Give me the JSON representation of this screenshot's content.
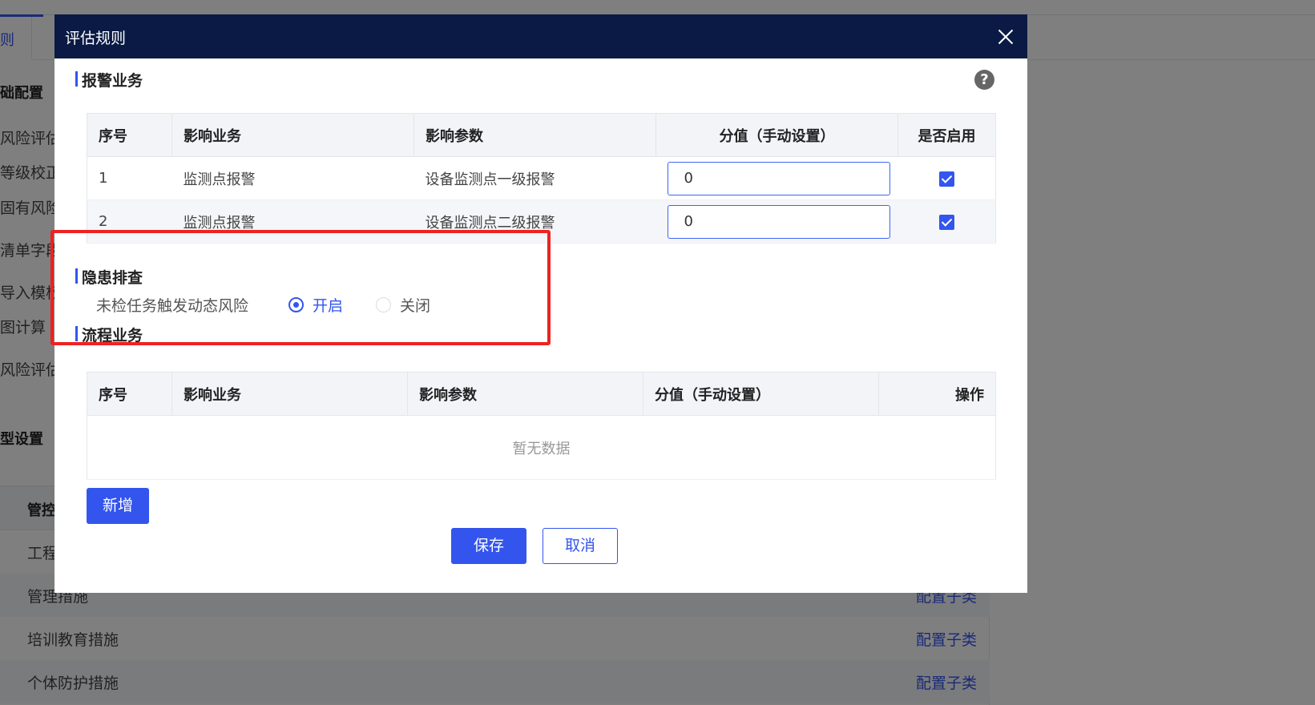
{
  "background": {
    "tab_label": "则",
    "headings": [
      "础配置",
      "型设置"
    ],
    "menu_items": [
      "风险评估",
      "等级校正",
      "固有风险",
      "清单字段",
      "导入模板",
      "图计算",
      "风险评估"
    ],
    "table_header": "管控",
    "rows": [
      {
        "label": "工程",
        "link": ""
      },
      {
        "label": "管理措施",
        "link": "配置子类"
      },
      {
        "label": "培训教育措施",
        "link": "配置子类"
      },
      {
        "label": "个体防护措施",
        "link": "配置子类"
      }
    ]
  },
  "modal": {
    "title": "评估规则",
    "alert_section": {
      "title": "报警业务",
      "columns": [
        "序号",
        "影响业务",
        "影响参数",
        "分值（手动设置）",
        "是否启用"
      ],
      "rows": [
        {
          "index": "1",
          "business": "监测点报警",
          "param": "设备监测点一级报警",
          "score": "0",
          "enabled": true
        },
        {
          "index": "2",
          "business": "监测点报警",
          "param": "设备监测点二级报警",
          "score": "0",
          "enabled": true
        }
      ]
    },
    "hazard_section": {
      "title": "隐患排查",
      "label": "未检任务触发动态风险",
      "options": [
        "开启",
        "关闭"
      ],
      "selected": "开启"
    },
    "flow_section": {
      "title": "流程业务",
      "columns": [
        "序号",
        "影响业务",
        "影响参数",
        "分值（手动设置）",
        "操作"
      ],
      "empty_text": "暂无数据",
      "add_label": "新增"
    },
    "save_label": "保存",
    "cancel_label": "取消"
  },
  "colors": {
    "primary": "#3355ee",
    "header": "#0a1a44",
    "highlight": "#ee2222"
  }
}
